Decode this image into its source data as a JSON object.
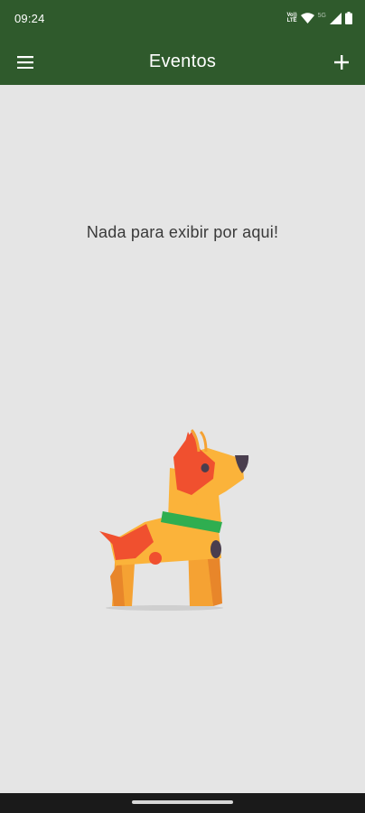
{
  "status_bar": {
    "time": "09:24",
    "volte_line1": "Vo))",
    "volte_line2": "LTE",
    "network_label": "5G",
    "icons": [
      "volte-icon",
      "wifi-icon",
      "cell-signal-icon",
      "battery-icon"
    ]
  },
  "app_bar": {
    "title": "Eventos",
    "menu_icon": "hamburger-menu-icon",
    "add_icon": "plus-icon",
    "background_color": "#2f5a2c"
  },
  "content": {
    "empty_message": "Nada para exibir por aqui!",
    "illustration": "dog-illustration",
    "background_color": "#e5e5e5"
  },
  "navigation": {
    "handle": "gesture-handle"
  }
}
